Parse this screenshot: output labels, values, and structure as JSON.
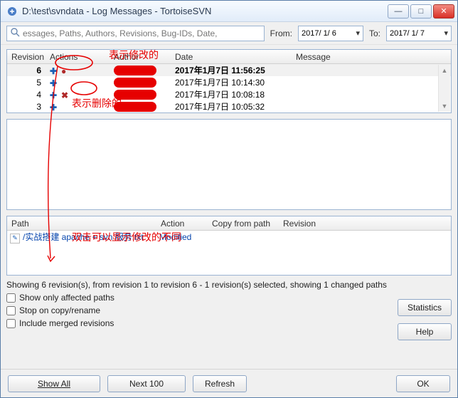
{
  "window": {
    "title": "D:\\test\\svndata - Log Messages - TortoiseSVN"
  },
  "search": {
    "placeholder": "essages, Paths, Authors, Revisions, Bug-IDs, Date,"
  },
  "daterange": {
    "from_label": "From:",
    "from_value": "2017/ 1/ 6",
    "to_label": "To:",
    "to_value": "2017/ 1/ 7"
  },
  "rev_headers": {
    "revision": "Revision",
    "actions": "Actions",
    "author": "Author",
    "date": "Date",
    "message": "Message"
  },
  "rev_rows": [
    {
      "rev": "6",
      "date": "2017年1月7日 11:56:25",
      "selected": true,
      "actions": [
        "add",
        "mod"
      ]
    },
    {
      "rev": "5",
      "date": "2017年1月7日 10:14:30",
      "selected": false,
      "actions": [
        "add"
      ]
    },
    {
      "rev": "4",
      "date": "2017年1月7日 10:08:18",
      "selected": false,
      "actions": [
        "add",
        "del"
      ]
    },
    {
      "rev": "3",
      "date": "2017年1月7日 10:05:32",
      "selected": false,
      "actions": [
        "add"
      ]
    }
  ],
  "path_headers": {
    "path": "Path",
    "action": "Action",
    "copy_from_path": "Copy from path",
    "revision": "Revision"
  },
  "path_rows": [
    {
      "path": "/实战搭建 apache + svn 服务.txt",
      "action": "Modified"
    }
  ],
  "summary": "Showing 6 revision(s), from revision 1 to revision 6 - 1 revision(s) selected, showing 1 changed paths",
  "checks": {
    "only_affected": "Show only affected paths",
    "stop_on_copy": "Stop on copy/rename",
    "include_merged": "Include merged revisions"
  },
  "buttons": {
    "statistics": "Statistics",
    "help": "Help",
    "show_all": "Show All",
    "next_100": "Next 100",
    "refresh": "Refresh",
    "ok": "OK"
  },
  "annotations": {
    "mod_label": "表示修改的",
    "del_label": "表示删除的",
    "dbl_label": "双击可以显示修改的不同"
  }
}
